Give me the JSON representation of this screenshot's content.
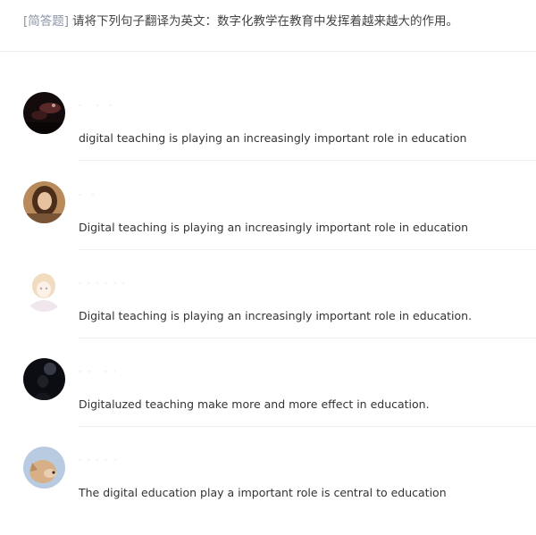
{
  "question": {
    "tag": "[简答题]",
    "text": "请将下列句子翻译为英文：数字化教学在教育中发挥着越来越大的作用。"
  },
  "answers": [
    {
      "avatar": {
        "icon": "dark-photo-avatar-icon",
        "colors": [
          "#1a1010",
          "#5a2a2a"
        ]
      },
      "text": "digital teaching is playing an increasingly important role in education"
    },
    {
      "avatar": {
        "icon": "portrait-avatar-icon",
        "colors": [
          "#c89a6e",
          "#5a3a22"
        ]
      },
      "text": "Digital teaching is playing an increasingly important role in education"
    },
    {
      "avatar": {
        "icon": "anime-avatar-icon",
        "colors": [
          "#f3ece6",
          "#e8c9a8"
        ]
      },
      "text": "Digital teaching is playing an increasingly important role in education."
    },
    {
      "avatar": {
        "icon": "dark-figure-avatar-icon",
        "colors": [
          "#0d0f14",
          "#3a3f4a"
        ]
      },
      "text": "Digitaluzed teaching make more and more effect in education."
    },
    {
      "avatar": {
        "icon": "dog-avatar-icon",
        "colors": [
          "#d9b38c",
          "#9fb6cf"
        ]
      },
      "text": "The digital education play a important role is central to education"
    }
  ]
}
